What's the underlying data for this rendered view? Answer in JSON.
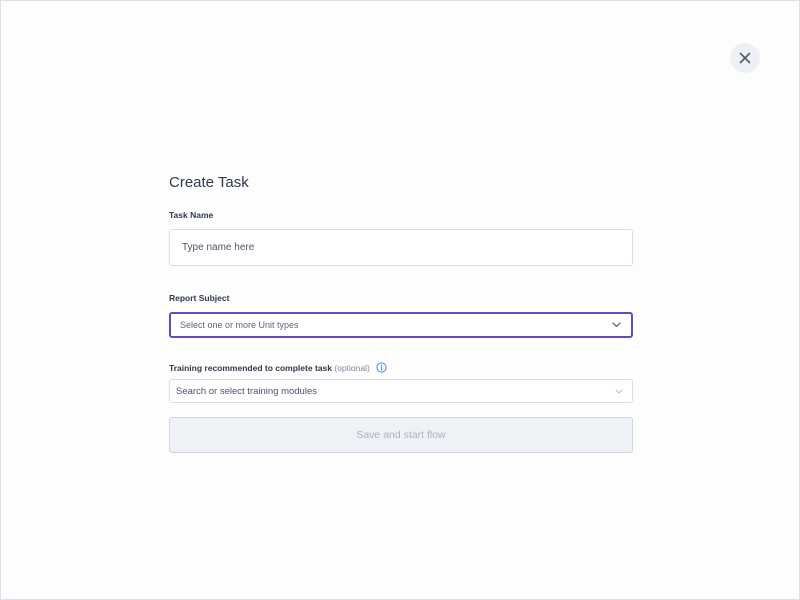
{
  "close": {
    "icon": "close-icon"
  },
  "form": {
    "title": "Create Task",
    "task_name": {
      "label": "Task Name",
      "placeholder": "Type name here",
      "value": ""
    },
    "report_subject": {
      "label": "Report Subject",
      "placeholder": "Select one or more Unit types",
      "icon": "chevron-down-icon"
    },
    "training": {
      "label": "Training recommended to complete task",
      "optional": "(optional)",
      "info_icon": "info-icon",
      "placeholder": "Search or select training modules",
      "icon": "chevron-down-icon"
    },
    "submit_label": "Save and start flow"
  },
  "colors": {
    "accent": "#6b46c1",
    "info": "#4a90d9",
    "disabled_text": "#a7b3c2"
  }
}
